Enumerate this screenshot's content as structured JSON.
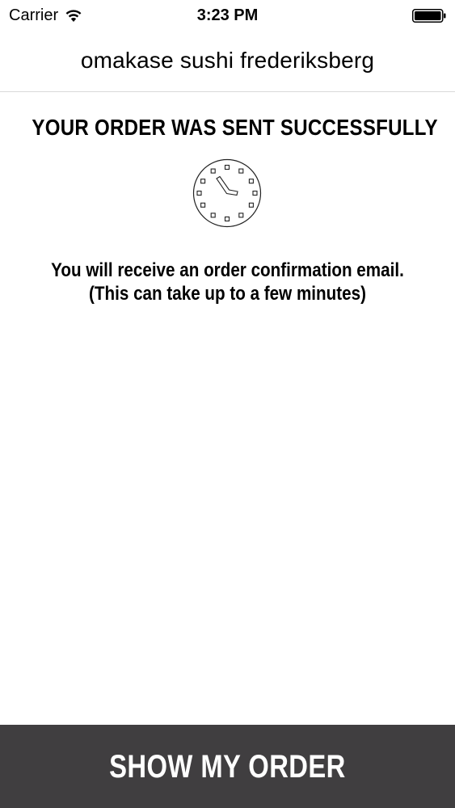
{
  "status_bar": {
    "carrier": "Carrier",
    "time": "3:23 PM",
    "wifi_icon": "wifi-icon",
    "battery_icon": "battery-icon"
  },
  "nav_bar": {
    "title": "omakase sushi frederiksberg"
  },
  "content": {
    "headline": "YOUR ORDER WAS SENT SUCCESSFULLY",
    "icon": "clock-icon",
    "message_line1": "You will receive an order confirmation email.",
    "message_line2": "(This can take up to a few minutes)"
  },
  "footer": {
    "button_label": "SHOW MY ORDER",
    "button_color": "#403e40"
  }
}
